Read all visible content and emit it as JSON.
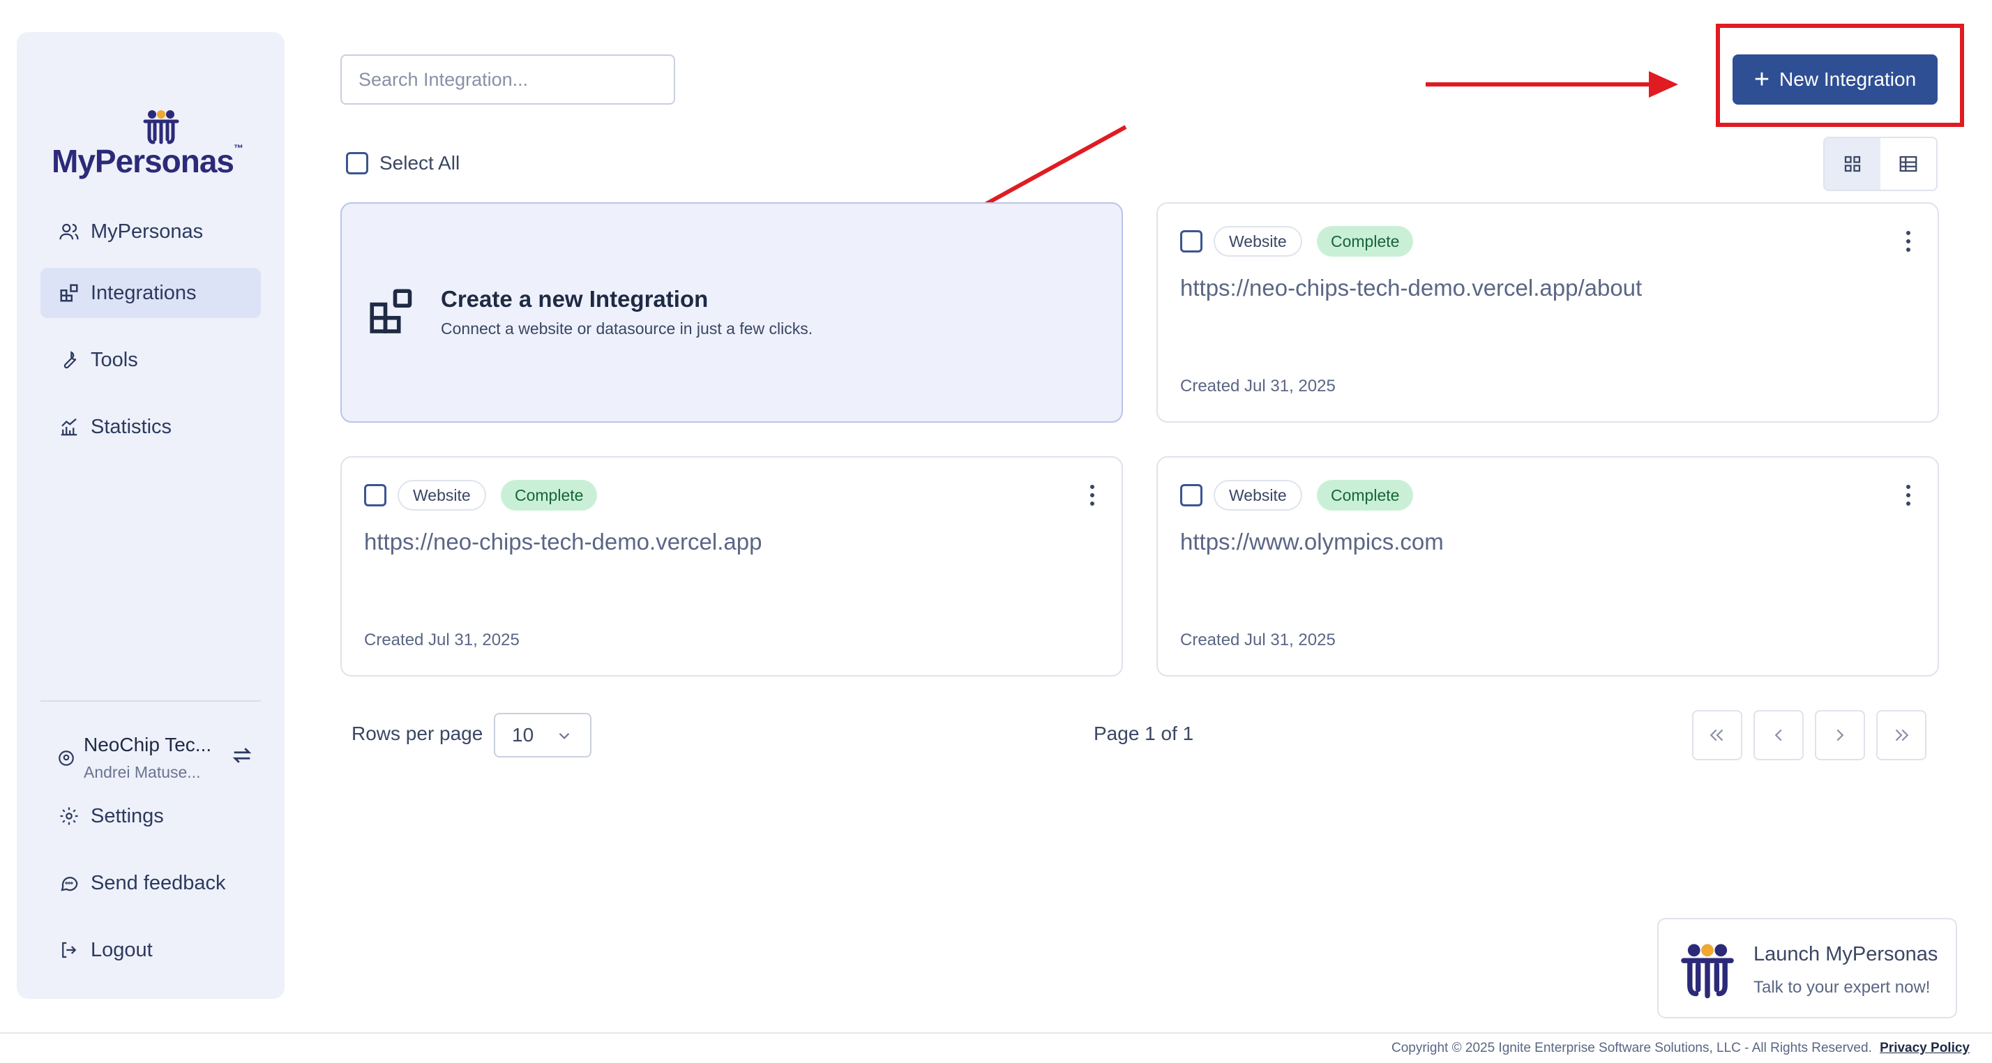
{
  "app": {
    "logo_text": "MyPersonas",
    "logo_tm": "™"
  },
  "sidebar": {
    "items": [
      {
        "label": "MyPersonas",
        "icon": "users-icon"
      },
      {
        "label": "Integrations",
        "icon": "integrations-icon",
        "active": true
      },
      {
        "label": "Tools",
        "icon": "wrench-icon"
      },
      {
        "label": "Statistics",
        "icon": "chart-icon"
      }
    ],
    "org": {
      "name": "NeoChip Tec...",
      "user": "Andrei Matuse..."
    },
    "bottom_items": [
      {
        "label": "Settings",
        "icon": "gear-icon"
      },
      {
        "label": "Send feedback",
        "icon": "feedback-icon"
      },
      {
        "label": "Logout",
        "icon": "logout-icon"
      }
    ]
  },
  "search": {
    "placeholder": "Search Integration..."
  },
  "toolbar": {
    "new_label": "New Integration",
    "select_all": "Select All"
  },
  "create_card": {
    "title": "Create a new Integration",
    "subtitle": "Connect a website or datasource in just a few clicks."
  },
  "integrations": [
    {
      "type": "Website",
      "status": "Complete",
      "url": "https://neo-chips-tech-demo.vercel.app/about",
      "created": "Created Jul 31, 2025"
    },
    {
      "type": "Website",
      "status": "Complete",
      "url": "https://neo-chips-tech-demo.vercel.app",
      "created": "Created Jul 31, 2025"
    },
    {
      "type": "Website",
      "status": "Complete",
      "url": "https://www.olympics.com",
      "created": "Created Jul 31, 2025"
    }
  ],
  "pagination": {
    "rows_label": "Rows per page",
    "rows_value": "10",
    "page_info": "Page 1 of 1"
  },
  "launch": {
    "title": "Launch MyPersonas",
    "subtitle": "Talk to your expert now!"
  },
  "footer": {
    "copyright": "Copyright © 2025 Ignite Enterprise Software Solutions, LLC - All Rights Reserved.",
    "privacy": "Privacy Policy"
  },
  "colors": {
    "accent": "#2f4f94",
    "annotation": "#e01b22",
    "status_bg": "#c9f0d6",
    "sidebar_bg": "#eef1fa"
  }
}
